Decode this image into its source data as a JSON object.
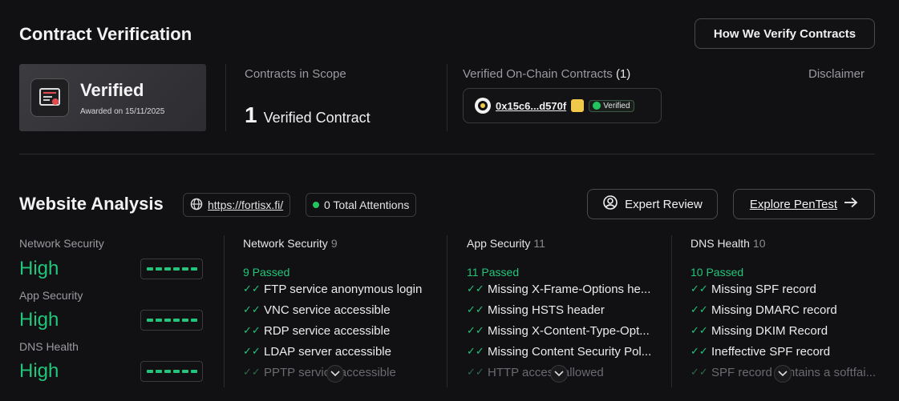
{
  "contract_verification": {
    "title": "Contract Verification",
    "how_button": "How We Verify Contracts",
    "badge": {
      "title": "Verified",
      "awarded": "Awarded on 15/11/2025"
    },
    "scope": {
      "label": "Contracts in Scope",
      "count": "1",
      "text": "Verified Contract"
    },
    "onchain": {
      "label": "Verified On-Chain Contracts",
      "count": "(1)",
      "address": "0x15c6...d570f",
      "status": "Verified"
    },
    "disclaimer": "Disclaimer"
  },
  "website_analysis": {
    "title": "Website Analysis",
    "url": "https://fortisx.fi/",
    "attentions": "0 Total Attentions",
    "expert_button": "Expert Review",
    "pentest_button": "Explore PenTest",
    "scores": [
      {
        "label": "Network Security",
        "value": "High"
      },
      {
        "label": "App Security",
        "value": "High"
      },
      {
        "label": "DNS Health",
        "value": "High"
      }
    ],
    "columns": [
      {
        "title": "Network Security",
        "count": "9",
        "passed": "9 Passed",
        "items": [
          "FTP service anonymous login",
          "VNC service accessible",
          "RDP service accessible",
          "LDAP server accessible",
          "PPTP service accessible"
        ]
      },
      {
        "title": "App Security",
        "count": "11",
        "passed": "11 Passed",
        "items": [
          "Missing X-Frame-Options he...",
          "Missing HSTS header",
          "Missing X-Content-Type-Opt...",
          "Missing Content Security Pol...",
          "HTTP access allowed"
        ]
      },
      {
        "title": "DNS Health",
        "count": "10",
        "passed": "10 Passed",
        "items": [
          "Missing SPF record",
          "Missing DMARC record",
          "Missing DKIM Record",
          "Ineffective SPF record",
          "SPF record contains a softfai..."
        ]
      }
    ]
  },
  "colors": {
    "accent_green": "#22c57a",
    "background": "#111113"
  }
}
